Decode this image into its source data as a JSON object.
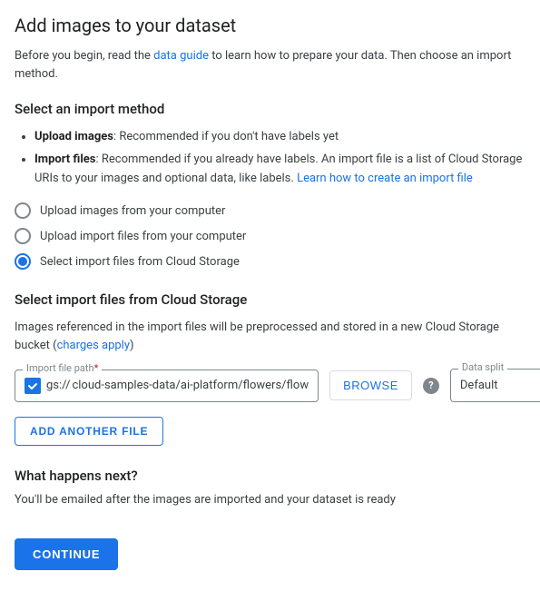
{
  "page": {
    "title": "Add images to your dataset",
    "intro": {
      "text_before_link": "Before you begin, read the ",
      "link_text": "data guide",
      "text_after_link": " to learn how to prepare your data. Then choose an import method."
    }
  },
  "import_method_section": {
    "title": "Select an import method",
    "bullets": [
      {
        "term": "Upload images",
        "desc": ": Recommended if you don't have labels yet"
      },
      {
        "term": "Import files",
        "desc": ": Recommended if you already have labels. An import file is a list of Cloud Storage URIs to your images and optional data, like labels.",
        "link_text": "Learn how to create an import file",
        "link_href": "#"
      }
    ],
    "options": [
      {
        "id": "upload-images",
        "label": "Upload images from your computer",
        "selected": false
      },
      {
        "id": "upload-import-files",
        "label": "Upload import files from your computer",
        "selected": false
      },
      {
        "id": "select-cloud-storage",
        "label": "Select import files from Cloud Storage",
        "selected": true
      }
    ]
  },
  "cloud_storage_section": {
    "title": "Select import files from Cloud Storage",
    "description": "Images referenced in the import files will be preprocessed and stored in a new Cloud Storage bucket (",
    "link_text": "charges apply",
    "description_end": ")",
    "file_path_label": "Import file path",
    "file_path_required": "*",
    "gs_prefix": "gs://",
    "file_path_value": "cloud-samples-data/ai-platform/flowers/flow",
    "browse_button_label": "BROWSE",
    "data_split_label": "Data split",
    "data_split_value": "Default",
    "add_file_button_label": "ADD ANOTHER FILE"
  },
  "what_next_section": {
    "title": "What happens next?",
    "description": "You'll be emailed after the images are imported and your dataset is ready"
  },
  "footer": {
    "continue_button_label": "CONTINUE"
  },
  "icons": {
    "help": "?",
    "checkmark": "✓",
    "dropdown_arrow": "▾"
  }
}
